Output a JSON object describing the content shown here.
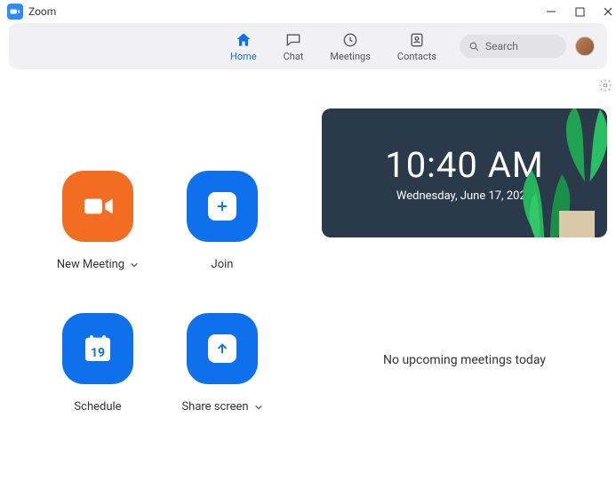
{
  "titlebar": {
    "title": "Zoom"
  },
  "nav": {
    "home": "Home",
    "chat": "Chat",
    "meetings": "Meetings",
    "contacts": "Contacts"
  },
  "search": {
    "placeholder": "Search"
  },
  "actions": {
    "new_meeting": "New Meeting",
    "join": "Join",
    "schedule": "Schedule",
    "share_screen": "Share screen",
    "calendar_day": "19"
  },
  "clock": {
    "time": "10:40 AM",
    "date": "Wednesday, June 17, 2020"
  },
  "upcoming": {
    "empty_message": "No upcoming meetings today"
  }
}
